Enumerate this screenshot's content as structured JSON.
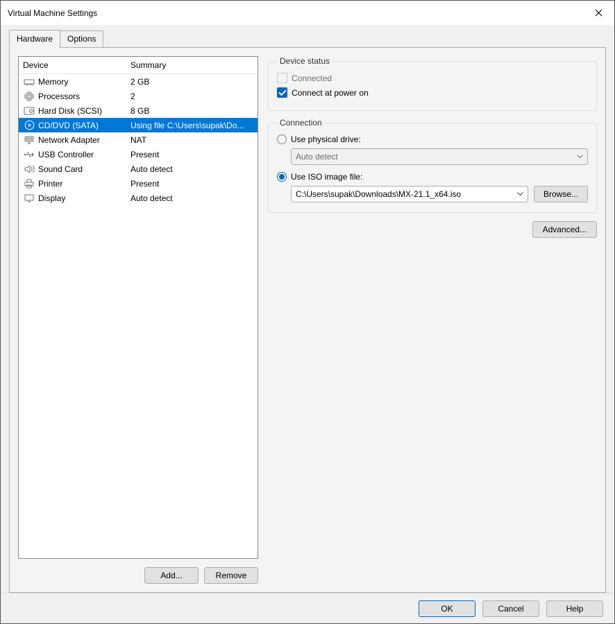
{
  "title": "Virtual Machine Settings",
  "tabs": {
    "hardware": "Hardware",
    "options": "Options"
  },
  "columns": {
    "device": "Device",
    "summary": "Summary"
  },
  "devices": [
    {
      "name": "Memory",
      "summary": "2 GB",
      "icon": "memory"
    },
    {
      "name": "Processors",
      "summary": "2",
      "icon": "cpu"
    },
    {
      "name": "Hard Disk (SCSI)",
      "summary": "8 GB",
      "icon": "disk"
    },
    {
      "name": "CD/DVD (SATA)",
      "summary": "Using file C:\\Users\\supak\\Do...",
      "icon": "cd",
      "selected": true
    },
    {
      "name": "Network Adapter",
      "summary": "NAT",
      "icon": "net"
    },
    {
      "name": "USB Controller",
      "summary": "Present",
      "icon": "usb"
    },
    {
      "name": "Sound Card",
      "summary": "Auto detect",
      "icon": "sound"
    },
    {
      "name": "Printer",
      "summary": "Present",
      "icon": "printer"
    },
    {
      "name": "Display",
      "summary": "Auto detect",
      "icon": "display"
    }
  ],
  "left_buttons": {
    "add": "Add...",
    "remove": "Remove"
  },
  "status": {
    "legend": "Device status",
    "connected": "Connected",
    "connected_checked": false,
    "connected_enabled": false,
    "poweron": "Connect at power on",
    "poweron_checked": true
  },
  "connection": {
    "legend": "Connection",
    "physical": "Use physical drive:",
    "physical_selected": false,
    "physical_combo": "Auto detect",
    "iso": "Use ISO image file:",
    "iso_selected": true,
    "iso_path": "C:\\Users\\supak\\Downloads\\MX-21.1_x64.iso",
    "browse": "Browse..."
  },
  "advanced": "Advanced...",
  "footer": {
    "ok": "OK",
    "cancel": "Cancel",
    "help": "Help"
  }
}
